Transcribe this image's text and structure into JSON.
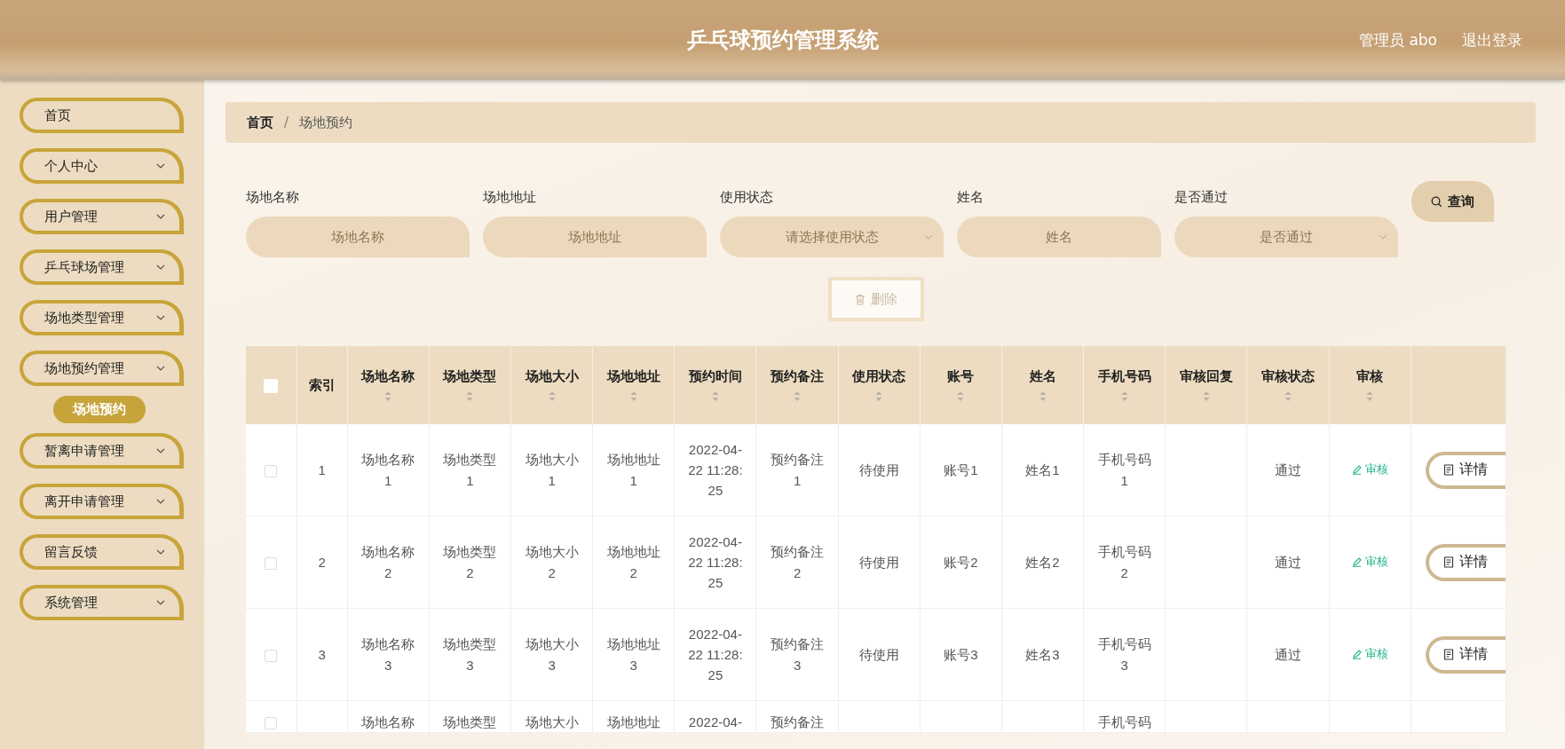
{
  "header": {
    "title": "乒乓球预约管理系统",
    "user": "管理员 abo",
    "logout": "退出登录"
  },
  "sidebar": {
    "items": [
      {
        "label": "首页",
        "expandable": false
      },
      {
        "label": "个人中心",
        "expandable": true
      },
      {
        "label": "用户管理",
        "expandable": true
      },
      {
        "label": "乒乓球场管理",
        "expandable": true
      },
      {
        "label": "场地类型管理",
        "expandable": true
      },
      {
        "label": "场地预约管理",
        "expandable": true,
        "children": [
          {
            "label": "场地预约",
            "selected": true
          }
        ]
      },
      {
        "label": "暂离申请管理",
        "expandable": true
      },
      {
        "label": "离开申请管理",
        "expandable": true
      },
      {
        "label": "留言反馈",
        "expandable": true
      },
      {
        "label": "系统管理",
        "expandable": true
      }
    ]
  },
  "breadcrumb": {
    "items": [
      "首页",
      "场地预约"
    ],
    "separator": "/"
  },
  "filters": [
    {
      "label": "场地名称",
      "placeholder": "场地名称",
      "kind": "input"
    },
    {
      "label": "场地地址",
      "placeholder": "场地地址",
      "kind": "input"
    },
    {
      "label": "使用状态",
      "placeholder": "请选择使用状态",
      "kind": "select"
    },
    {
      "label": "姓名",
      "placeholder": "姓名",
      "kind": "input"
    },
    {
      "label": "是否通过",
      "placeholder": "是否通过",
      "kind": "select"
    }
  ],
  "search_button": "查询",
  "delete_button": {
    "label": "删除",
    "disabled": true
  },
  "table": {
    "select_all": {
      "checked": false
    },
    "columns": [
      {
        "label": "索引",
        "sortable": false
      },
      {
        "label": "场地名称",
        "sortable": true
      },
      {
        "label": "场地类型",
        "sortable": true
      },
      {
        "label": "场地大小",
        "sortable": true
      },
      {
        "label": "场地地址",
        "sortable": true
      },
      {
        "label": "预约时间",
        "sortable": true
      },
      {
        "label": "预约备注",
        "sortable": true
      },
      {
        "label": "使用状态",
        "sortable": true
      },
      {
        "label": "账号",
        "sortable": true
      },
      {
        "label": "姓名",
        "sortable": true
      },
      {
        "label": "手机号码",
        "sortable": true
      },
      {
        "label": "审核回复",
        "sortable": true
      },
      {
        "label": "审核状态",
        "sortable": true
      },
      {
        "label": "审核",
        "sortable": true
      }
    ],
    "rows": [
      {
        "checked": false,
        "cells": [
          "1",
          "场地名称1",
          "场地类型1",
          "场地大小1",
          "场地地址1",
          "2022-04-22 11:28:25",
          "预约备注1",
          "待使用",
          "账号1",
          "姓名1",
          "手机号码1",
          null,
          "通过"
        ],
        "review_action": "审核",
        "detail_button": "详情"
      },
      {
        "checked": false,
        "cells": [
          "2",
          "场地名称2",
          "场地类型2",
          "场地大小2",
          "场地地址2",
          "2022-04-22 11:28:25",
          "预约备注2",
          "待使用",
          "账号2",
          "姓名2",
          "手机号码2",
          null,
          "通过"
        ],
        "review_action": "审核",
        "detail_button": "详情"
      },
      {
        "checked": false,
        "cells": [
          "3",
          "场地名称3",
          "场地类型3",
          "场地大小3",
          "场地地址3",
          "2022-04-22 11:28:25",
          "预约备注3",
          "待使用",
          "账号3",
          "姓名3",
          "手机号码3",
          null,
          "通过"
        ],
        "review_action": "审核",
        "detail_button": "详情"
      },
      {
        "checked": false,
        "cells": [
          null,
          "场地名称",
          "场地类型",
          "场地大小",
          "场地地址",
          "2022-04-",
          "预约备注",
          null,
          null,
          null,
          "手机号码",
          null,
          null
        ]
      }
    ]
  }
}
